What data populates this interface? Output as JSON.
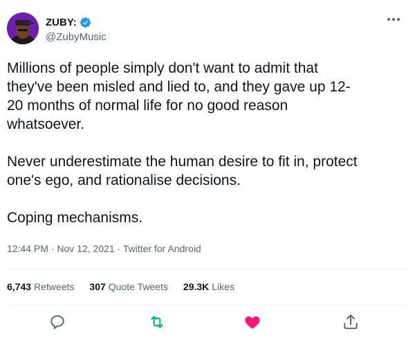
{
  "author": {
    "display_name": "ZUBY:",
    "handle": "@ZubyMusic",
    "verified": true
  },
  "tweet": {
    "text": "Millions of people simply don't want to admit that\nthey've been misled and lied to, and they gave up 12-\n20 months of normal life for no good reason\nwhatsoever.\n\nNever underestimate the human desire to fit in, protect\none's ego, and rationalise decisions.\n\nCoping mechanisms.",
    "time": "12:44 PM",
    "date": "Nov 12, 2021",
    "source": "Twitter for Android",
    "separator": "·"
  },
  "stats": {
    "retweets_count": "6,743",
    "retweets_label": "Retweets",
    "quotes_count": "307",
    "quotes_label": "Quote Tweets",
    "likes_count": "29.3K",
    "likes_label": "Likes"
  },
  "colors": {
    "verified": "#1d9bf0",
    "retweet": "#00ba7c",
    "like": "#f91880",
    "muted": "#536471"
  },
  "icons": [
    "verified-badge-icon",
    "more-icon",
    "reply-icon",
    "retweet-icon",
    "like-icon",
    "share-icon"
  ]
}
